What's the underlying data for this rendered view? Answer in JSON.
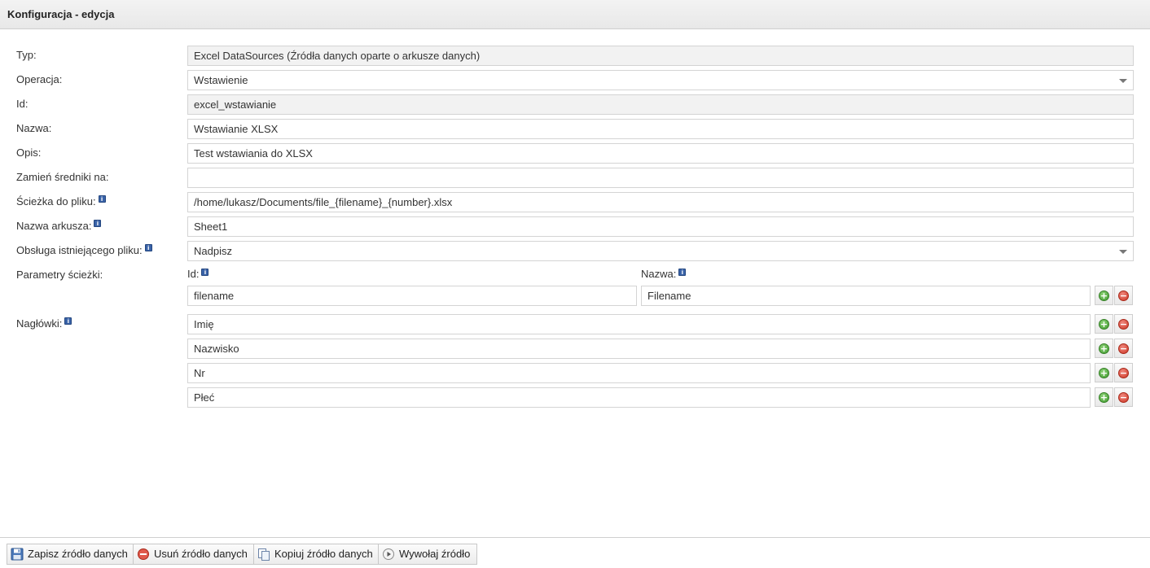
{
  "header": {
    "title": "Konfiguracja - edycja"
  },
  "form": {
    "typ": {
      "label": "Typ:",
      "value": "Excel DataSources (Źródła danych oparte o arkusze danych)"
    },
    "operacja": {
      "label": "Operacja:",
      "value": "Wstawienie"
    },
    "id": {
      "label": "Id:",
      "value": "excel_wstawianie"
    },
    "nazwa": {
      "label": "Nazwa:",
      "value": "Wstawianie XLSX"
    },
    "opis": {
      "label": "Opis:",
      "value": "Test wstawiania do XLSX"
    },
    "zamien": {
      "label": "Zamień średniki na:",
      "value": ""
    },
    "sciezka": {
      "label": "Ścieżka do pliku:",
      "value": "/home/lukasz/Documents/file_{filename}_{number}.xlsx"
    },
    "arkusz": {
      "label": "Nazwa arkusza:",
      "value": "Sheet1"
    },
    "obsluga": {
      "label": "Obsługa istniejącego pliku:",
      "value": "Nadpisz"
    },
    "parametry": {
      "label": "Parametry ścieżki:",
      "id_label": "Id:",
      "nazwa_label": "Nazwa:",
      "rows": [
        {
          "id": "filename",
          "nazwa": "Filename"
        }
      ]
    },
    "naglowki": {
      "label": "Nagłówki:",
      "rows": [
        "Imię",
        "Nazwisko",
        "Nr",
        "Płeć"
      ]
    }
  },
  "icons": {
    "info": "info-icon",
    "add": "add-icon",
    "remove": "remove-icon"
  },
  "footer": {
    "save": "Zapisz źródło danych",
    "delete": "Usuń źródło danych",
    "copy": "Kopiuj źródło danych",
    "invoke": "Wywołaj źródło"
  }
}
